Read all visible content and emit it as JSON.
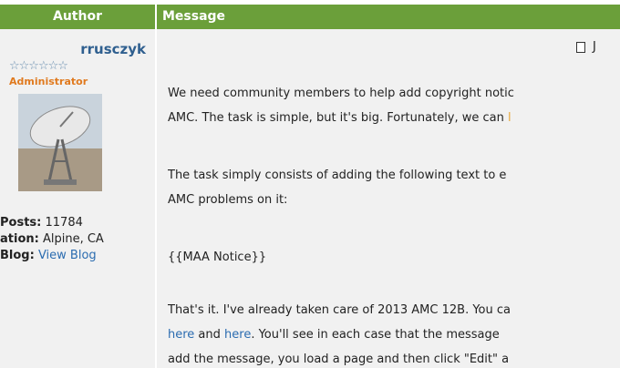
{
  "header": {
    "author_label": "Author",
    "message_label": "Message"
  },
  "author": {
    "username": "rrusczyk",
    "stars": "☆☆☆☆☆☆",
    "role": "Administrator",
    "posts_label": "Posts:",
    "posts_value": "11784",
    "location_label": "ation:",
    "location_value": "Alpine, CA",
    "blog_label": "Blog:",
    "blog_link": "View Blog"
  },
  "post": {
    "date_initial": "J",
    "p1_line1": "We need community members to help add copyright notic",
    "p1_line2_a": "AMC. The task is simple, but it's big. Fortunately, we can ",
    "p1_line2_b": "l",
    "p2_line1": "The task simply consists of adding the following text to e",
    "p2_line2": "AMC problems on it:",
    "notice": "{{MAA Notice}}",
    "p3_line1": "That's it. I've already taken care of 2013 AMC 12B. You ca",
    "p3_link1": "here",
    "p3_and": " and ",
    "p3_link2": "here",
    "p3_rest": ". You'll see in each case that the message",
    "p3_line3": "add the message, you load a page and then click \"Edit\" a"
  },
  "colors": {
    "header_green": "#6b9f3a",
    "username_blue": "#2f5f8f",
    "role_orange": "#e07a1f",
    "link_blue": "#2b6cb0"
  }
}
